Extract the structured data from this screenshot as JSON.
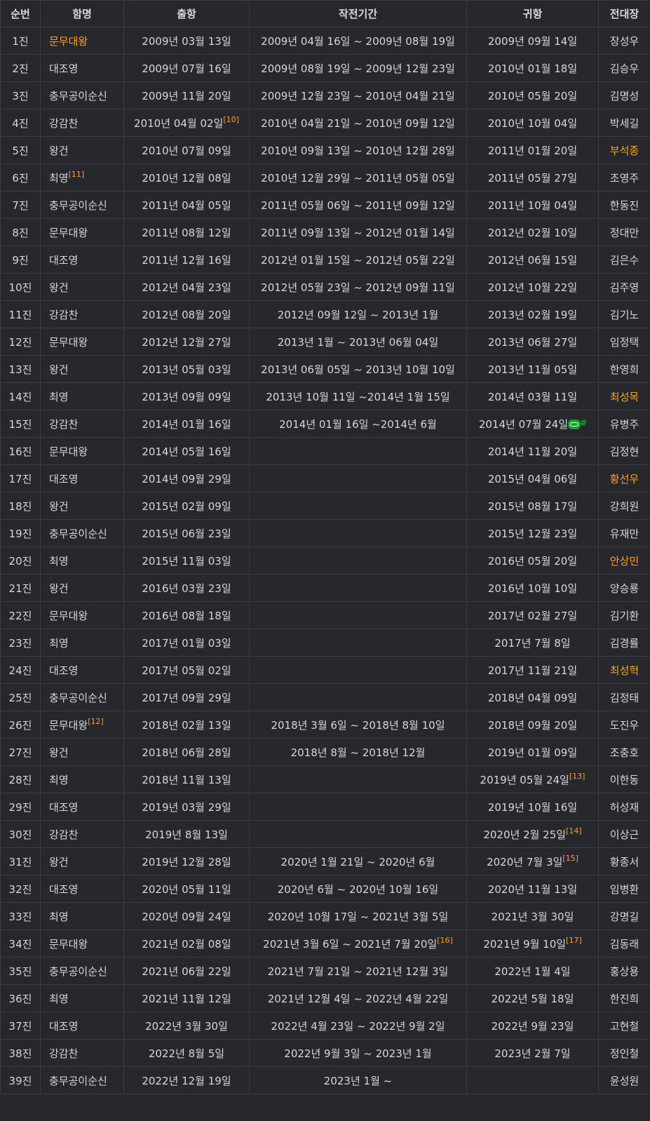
{
  "headers": [
    "순번",
    "함명",
    "출항",
    "작전기간",
    "귀항",
    "전대장"
  ],
  "rows": [
    {
      "num": "1진",
      "ship": "문무대왕",
      "ship_hl": true,
      "dep": "2009년 03월 13일",
      "period": "2009년 04월 16일 ~ 2009년 08월 19일",
      "ret": "2009년 09월 14일",
      "cmd": "장성우"
    },
    {
      "num": "2진",
      "ship": "대조영",
      "dep": "2009년 07월 16일",
      "period": "2009년 08월 19일 ~ 2009년 12월 23일",
      "ret": "2010년 01월 18일",
      "cmd": "김승우"
    },
    {
      "num": "3진",
      "ship": "충무공이순신",
      "dep": "2009년 11월 20일",
      "period": "2009년 12월 23일 ~ 2010년 04월 21일",
      "ret": "2010년 05월 20일",
      "cmd": "김명성"
    },
    {
      "num": "4진",
      "ship": "강감찬",
      "dep": "2010년 04월 02일",
      "dep_fn": "[10]",
      "period": "2010년 04월 21일 ~ 2010년 09월 12일",
      "ret": "2010년 10월 04일",
      "cmd": "박세길"
    },
    {
      "num": "5진",
      "ship": "왕건",
      "dep": "2010년 07월 09일",
      "period": "2010년 09월 13일 ~ 2010년 12월 28일",
      "ret": "2011년 01월 20일",
      "cmd": "부석종",
      "cmd_hl": true
    },
    {
      "num": "6진",
      "ship": "최영",
      "ship_fn": "[11]",
      "dep": "2010년 12월 08일",
      "period": "2010년 12월 29일 ~ 2011년 05월 05일",
      "ret": "2011년 05월 27일",
      "cmd": "조영주"
    },
    {
      "num": "7진",
      "ship": "충무공이순신",
      "dep": "2011년 04월 05일",
      "period": "2011년 05월 06일 ~ 2011년 09월 12일",
      "ret": "2011년 10월 04일",
      "cmd": "한동진"
    },
    {
      "num": "8진",
      "ship": "문무대왕",
      "dep": "2011년 08월 12일",
      "period": "2011년 09월 13일 ~ 2012년 01월 14일",
      "ret": "2012년 02월 10일",
      "cmd": "정대만"
    },
    {
      "num": "9진",
      "ship": "대조영",
      "dep": "2011년 12월 16일",
      "period": "2012년 01월 15일 ~ 2012년 05월 22일",
      "ret": "2012년 06월 15일",
      "cmd": "김은수"
    },
    {
      "num": "10진",
      "ship": "왕건",
      "dep": "2012년 04월 23일",
      "period": "2012년 05월 23일 ~ 2012년 09월 11일",
      "ret": "2012년 10월 22일",
      "cmd": "김주영"
    },
    {
      "num": "11진",
      "ship": "강감찬",
      "dep": "2012년 08월 20일",
      "period": "2012년 09월 12일 ~ 2013년 1월",
      "ret": "2013년 02월 19일",
      "cmd": "김기노"
    },
    {
      "num": "12진",
      "ship": "문무대왕",
      "dep": "2012년 12월 27일",
      "period": "2013년 1월 ~ 2013년 06월 04일",
      "ret": "2013년 06월 27일",
      "cmd": "임정택"
    },
    {
      "num": "13진",
      "ship": "왕건",
      "dep": "2013년 05월 03일",
      "period": "2013년 06월 05일 ~ 2013년 10월 10일",
      "ret": "2013년 11월 05일",
      "cmd": "한영희"
    },
    {
      "num": "14진",
      "ship": "최영",
      "dep": "2013년 09월 09일",
      "period": "2013년 10월 11일 ~2014년 1월 15일",
      "ret": "2014년 03월 11일",
      "cmd": "최성목",
      "cmd_hl": true
    },
    {
      "num": "15진",
      "ship": "강감찬",
      "dep": "2014년 01월 16일",
      "period": "2014년 01월 16일 ~2014년 6월",
      "ret": "2014년 07월 24일",
      "ret_link": true,
      "cmd": "유병주"
    },
    {
      "num": "16진",
      "ship": "문무대왕",
      "dep": "2014년 05월 16일",
      "period": "",
      "ret": "2014년 11월 20일",
      "cmd": "김정현"
    },
    {
      "num": "17진",
      "ship": "대조영",
      "dep": "2014년 09월 29일",
      "period": "",
      "ret": "2015년 04월 06일",
      "cmd": "황선우",
      "cmd_hl": true
    },
    {
      "num": "18진",
      "ship": "왕건",
      "dep": "2015년 02월 09일",
      "period": "",
      "ret": "2015년 08월 17일",
      "cmd": "강희원"
    },
    {
      "num": "19진",
      "ship": "충무공이순신",
      "dep": "2015년 06월 23일",
      "period": "",
      "ret": "2015년 12월 23일",
      "cmd": "유재만"
    },
    {
      "num": "20진",
      "ship": "최영",
      "dep": "2015년 11월 03일",
      "period": "",
      "ret": "2016년 05월 20일",
      "cmd": "안상민",
      "cmd_hl": true
    },
    {
      "num": "21진",
      "ship": "왕건",
      "dep": "2016년 03월 23일",
      "period": "",
      "ret": "2016년 10월 10일",
      "cmd": "양승룡"
    },
    {
      "num": "22진",
      "ship": "문무대왕",
      "dep": "2016년 08월 18일",
      "period": "",
      "ret": "2017년 02월 27일",
      "cmd": "김기환"
    },
    {
      "num": "23진",
      "ship": "최영",
      "dep": "2017년 01월 03일",
      "period": "",
      "ret": "2017년 7월 8일",
      "cmd": "김경률"
    },
    {
      "num": "24진",
      "ship": "대조영",
      "dep": "2017년 05월 02일",
      "period": "",
      "ret": "2017년 11월 21일",
      "cmd": "최성혁",
      "cmd_hl": true
    },
    {
      "num": "25진",
      "ship": "충무공이순신",
      "dep": "2017년 09월 29일",
      "period": "",
      "ret": "2018년 04월 09일",
      "cmd": "김정태"
    },
    {
      "num": "26진",
      "ship": "문무대왕",
      "ship_fn": "[12]",
      "dep": "2018년 02월 13일",
      "period": "2018년 3월 6일 ~ 2018년 8월 10일",
      "ret": "2018년 09월 20일",
      "cmd": "도진우"
    },
    {
      "num": "27진",
      "ship": "왕건",
      "dep": "2018년 06월 28일",
      "period": "2018년 8월 ~ 2018년 12월",
      "ret": "2019년 01월 09일",
      "cmd": "조충호"
    },
    {
      "num": "28진",
      "ship": "최영",
      "dep": "2018년 11월 13일",
      "period": "",
      "ret": "2019년 05월 24일",
      "ret_fn": "[13]",
      "cmd": "이한동"
    },
    {
      "num": "29진",
      "ship": "대조영",
      "dep": "2019년 03월 29일",
      "period": "",
      "ret": "2019년 10월 16일",
      "cmd": "허성재"
    },
    {
      "num": "30진",
      "ship": "강감찬",
      "dep": "2019년 8월 13일",
      "period": "",
      "ret": "2020년 2월 25일",
      "ret_fn": "[14]",
      "cmd": "이상근"
    },
    {
      "num": "31진",
      "ship": "왕건",
      "dep": "2019년 12월 28일",
      "period": "2020년 1월 21일 ~ 2020년 6월",
      "ret": "2020년 7월 3일",
      "ret_fn": "[15]",
      "cmd": "황종서"
    },
    {
      "num": "32진",
      "ship": "대조영",
      "dep": "2020년 05월 11일",
      "period": "2020년 6월 ~ 2020년 10월 16일",
      "ret": "2020년 11월 13일",
      "cmd": "임병환"
    },
    {
      "num": "33진",
      "ship": "최영",
      "dep": "2020년 09월 24일",
      "period": "2020년 10월 17일 ~ 2021년 3월 5일",
      "ret": "2021년 3월 30일",
      "cmd": "강명길"
    },
    {
      "num": "34진",
      "ship": "문무대왕",
      "dep": "2021년 02월 08일",
      "period": "2021년 3월 6일 ~ 2021년 7월 20일",
      "period_fn": "[16]",
      "ret": "2021년 9월 10일",
      "ret_fn": "[17]",
      "cmd": "김동래"
    },
    {
      "num": "35진",
      "ship": "충무공이순신",
      "dep": "2021년 06월 22일",
      "period": "2021년 7월 21일 ~ 2021년 12월 3일",
      "ret": "2022년 1월 4일",
      "cmd": "홍상용"
    },
    {
      "num": "36진",
      "ship": "최영",
      "dep": "2021년 11월 12일",
      "period": "2021년 12월 4일 ~ 2022년 4월 22일",
      "ret": "2022년 5월 18일",
      "cmd": "한진희"
    },
    {
      "num": "37진",
      "ship": "대조영",
      "dep": "2022년 3월 30일",
      "period": "2022년 4월 23일 ~ 2022년 9월 2일",
      "ret": "2022년 9월 23일",
      "cmd": "고현철"
    },
    {
      "num": "38진",
      "ship": "강감찬",
      "dep": "2022년 8월 5일",
      "period": "2022년 9월 3일 ~ 2023년 1월",
      "ret": "2023년 2월 7일",
      "cmd": "정인철"
    },
    {
      "num": "39진",
      "ship": "충무공이순신",
      "dep": "2022년 12월 19일",
      "period": "2023년 1월 ~",
      "ret": "",
      "cmd": "윤성원"
    }
  ],
  "colors": {
    "background": "#27282d",
    "text": "#d7d8da",
    "highlight": "#ff9f2a",
    "border": "#3c3d43",
    "link": "#12a32c"
  },
  "icons": {
    "ret_link": "link-icon"
  }
}
